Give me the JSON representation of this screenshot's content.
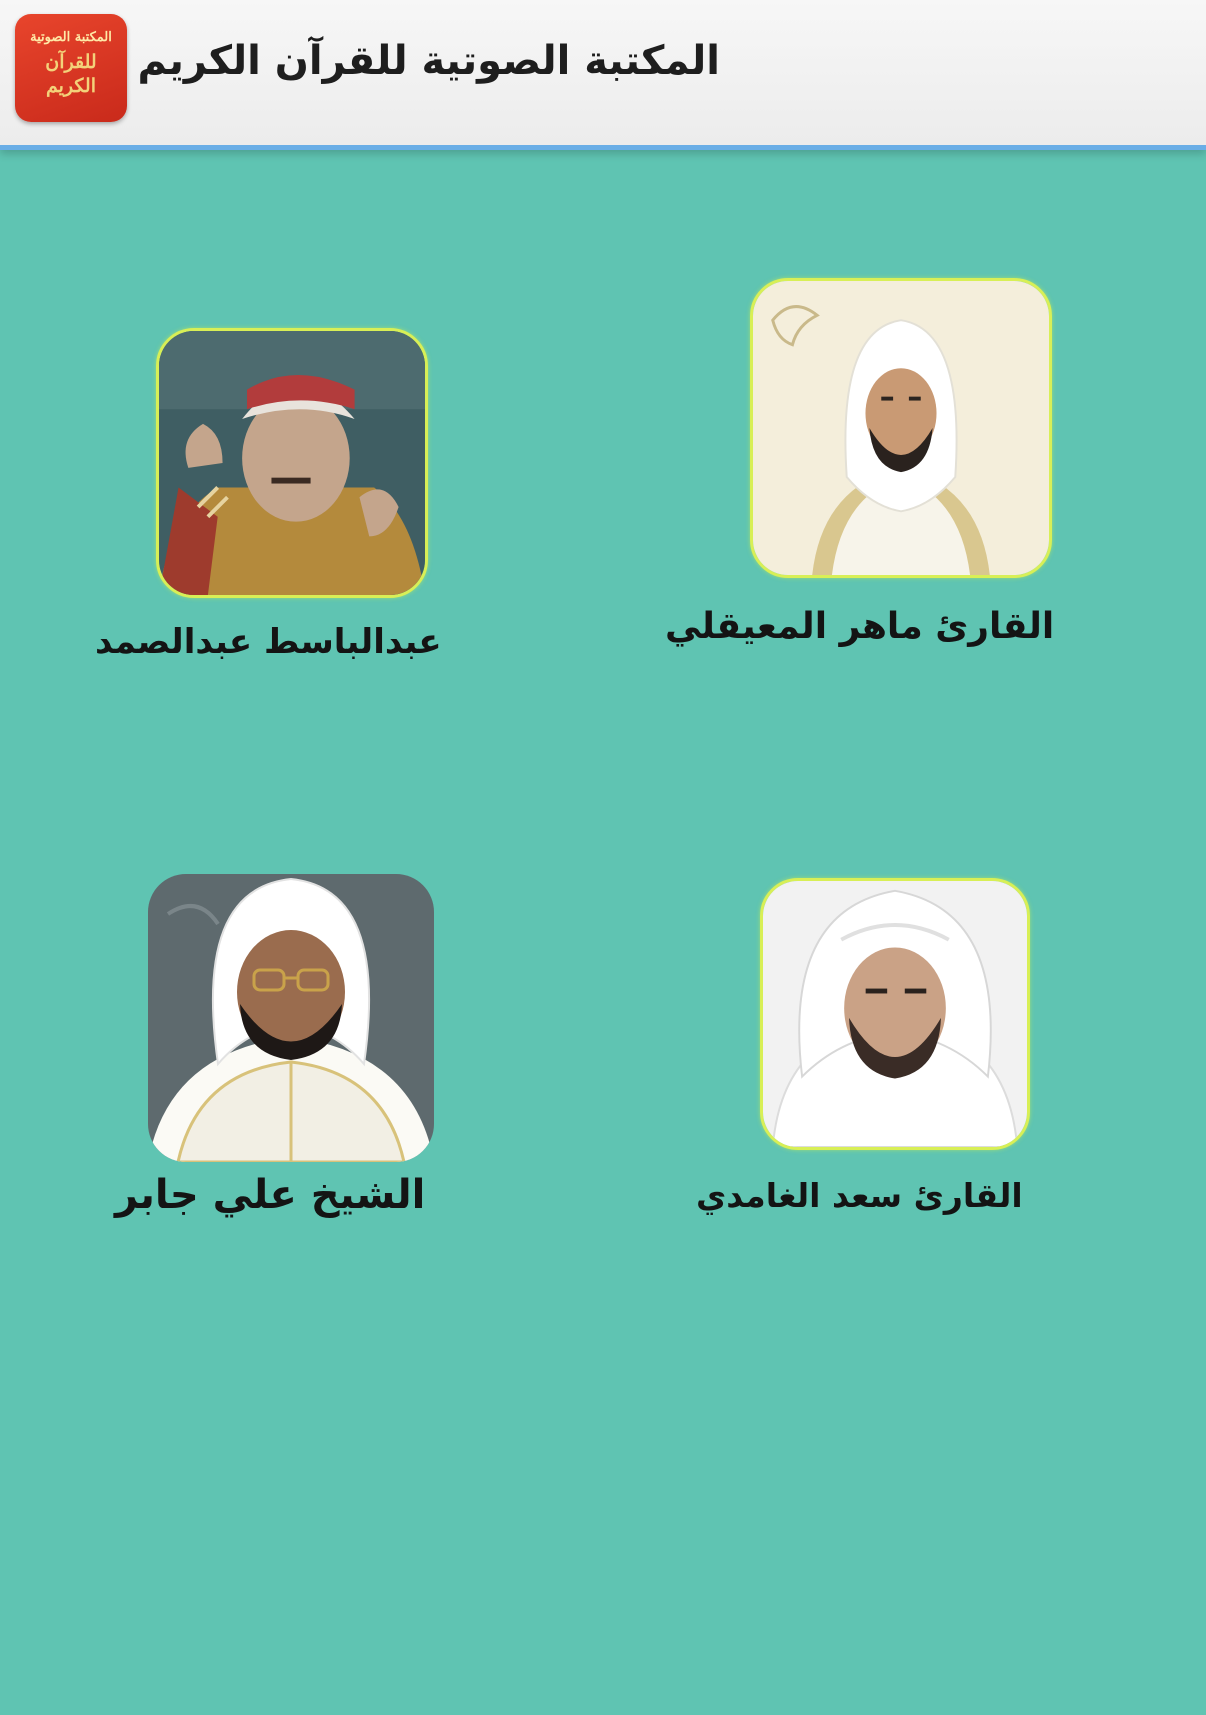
{
  "header": {
    "title": "المكتبة الصوتية للقرآن الكريم",
    "logo_lines": [
      "المكتبة الصوتية",
      "للقرآن",
      "الكريم"
    ]
  },
  "reciters": [
    {
      "name": "القارئ ماهر المعيقلي"
    },
    {
      "name": "عبدالباسط عبدالصمد"
    },
    {
      "name": "القارئ سعد الغامدي"
    },
    {
      "name": "الشيخ علي جابر"
    }
  ],
  "colors": {
    "background": "#5fc4b2",
    "app_bar": "#ececec",
    "app_bar_border": "#6aaee6",
    "avatar_border": "#d8ef56"
  }
}
